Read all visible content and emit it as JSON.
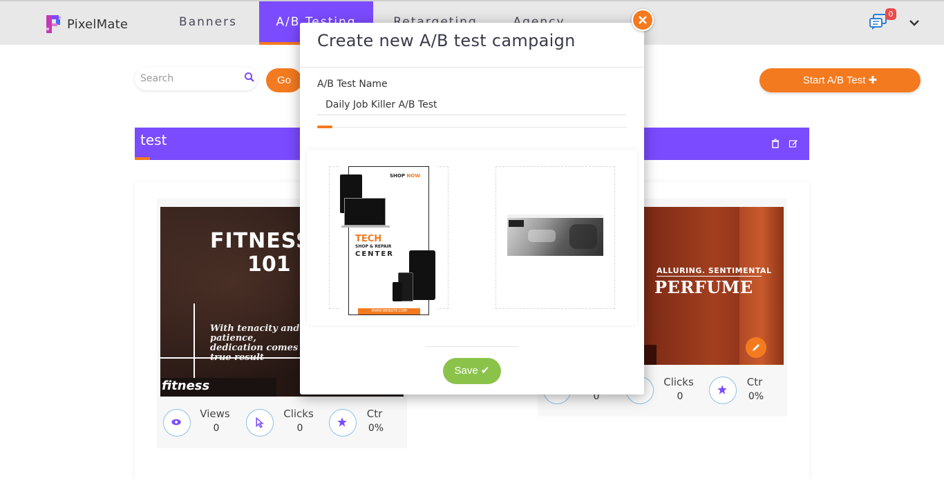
{
  "nav": {
    "logo_text": "PixelMate",
    "items": [
      {
        "label": "Banners"
      },
      {
        "label": "A/B Testing"
      },
      {
        "label": "Retargeting"
      },
      {
        "label": "Agency"
      }
    ],
    "notification_count": "0"
  },
  "toolbar": {
    "search_placeholder": "Search",
    "go_label": "Go",
    "start_label": "Start A/B Test ✚"
  },
  "test_group": {
    "title": "test"
  },
  "cards": [
    {
      "banner": {
        "title_line1": "FITNESS",
        "title_line2": "101",
        "tagline": "With tenacity and patience, dedication comes true result",
        "caption": "fitness"
      },
      "stats": {
        "views_label": "Views",
        "views_value": "0",
        "clicks_label": "Clicks",
        "clicks_value": "0",
        "ctr_label": "Ctr",
        "ctr_value": "0%"
      }
    },
    {
      "banner": {
        "subtitle": "ALLURING. SENTIMENTAL",
        "title": "PERFUME"
      },
      "stats": {
        "views_value": "0",
        "clicks_label": "Clicks",
        "clicks_value": "0",
        "ctr_label": "Ctr",
        "ctr_value": "0%"
      }
    }
  ],
  "modal": {
    "title": "Create new A/B test campaign",
    "name_label": "A/B Test Name",
    "name_value": "Daily Job Killer A/B Test",
    "banner_a": {
      "shop_now_1": "SHOP",
      "shop_now_2": "NOW",
      "tech": "TECH",
      "shop_repair": "SHOP & REPAIR",
      "center": "CENTER",
      "website": "WWW.WEBSITE.COM"
    },
    "save_label": "Save ✔"
  },
  "colors": {
    "accent_purple": "#7b4bff",
    "accent_orange": "#f47a20",
    "save_green": "#8bc34a"
  }
}
